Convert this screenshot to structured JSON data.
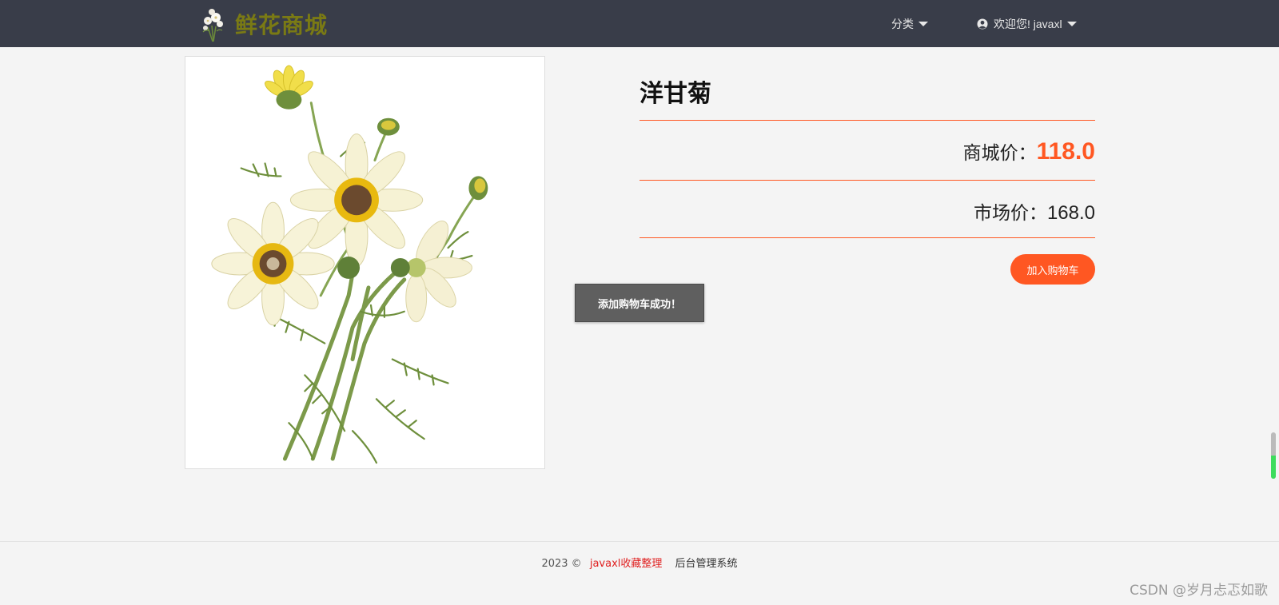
{
  "header": {
    "brand_title": "鲜花商城",
    "category_label": "分类",
    "user_label": "欢迎您! javaxl",
    "logo_icon": "flower-bouquet-icon",
    "user_icon": "user-circle-icon",
    "caret_icon": "caret-down-icon",
    "background_color": "#393d49",
    "brand_color": "#7a7a14"
  },
  "product": {
    "name": "洋甘菊",
    "image_icon": "chamomile-flower-image",
    "mall_price_label": "商城价：",
    "mall_price": "118.0",
    "market_price_label": "市场价：",
    "market_price": "168.0",
    "add_to_cart_label": "加入购物车",
    "accent_color": "#ff5722"
  },
  "toast": {
    "message": "添加购物车成功！"
  },
  "footer": {
    "copyright": "2023 ©",
    "brand_link": "javaxl收藏整理",
    "admin_link": "后台管理系统"
  },
  "watermark": "CSDN @岁月忐忑如歌"
}
